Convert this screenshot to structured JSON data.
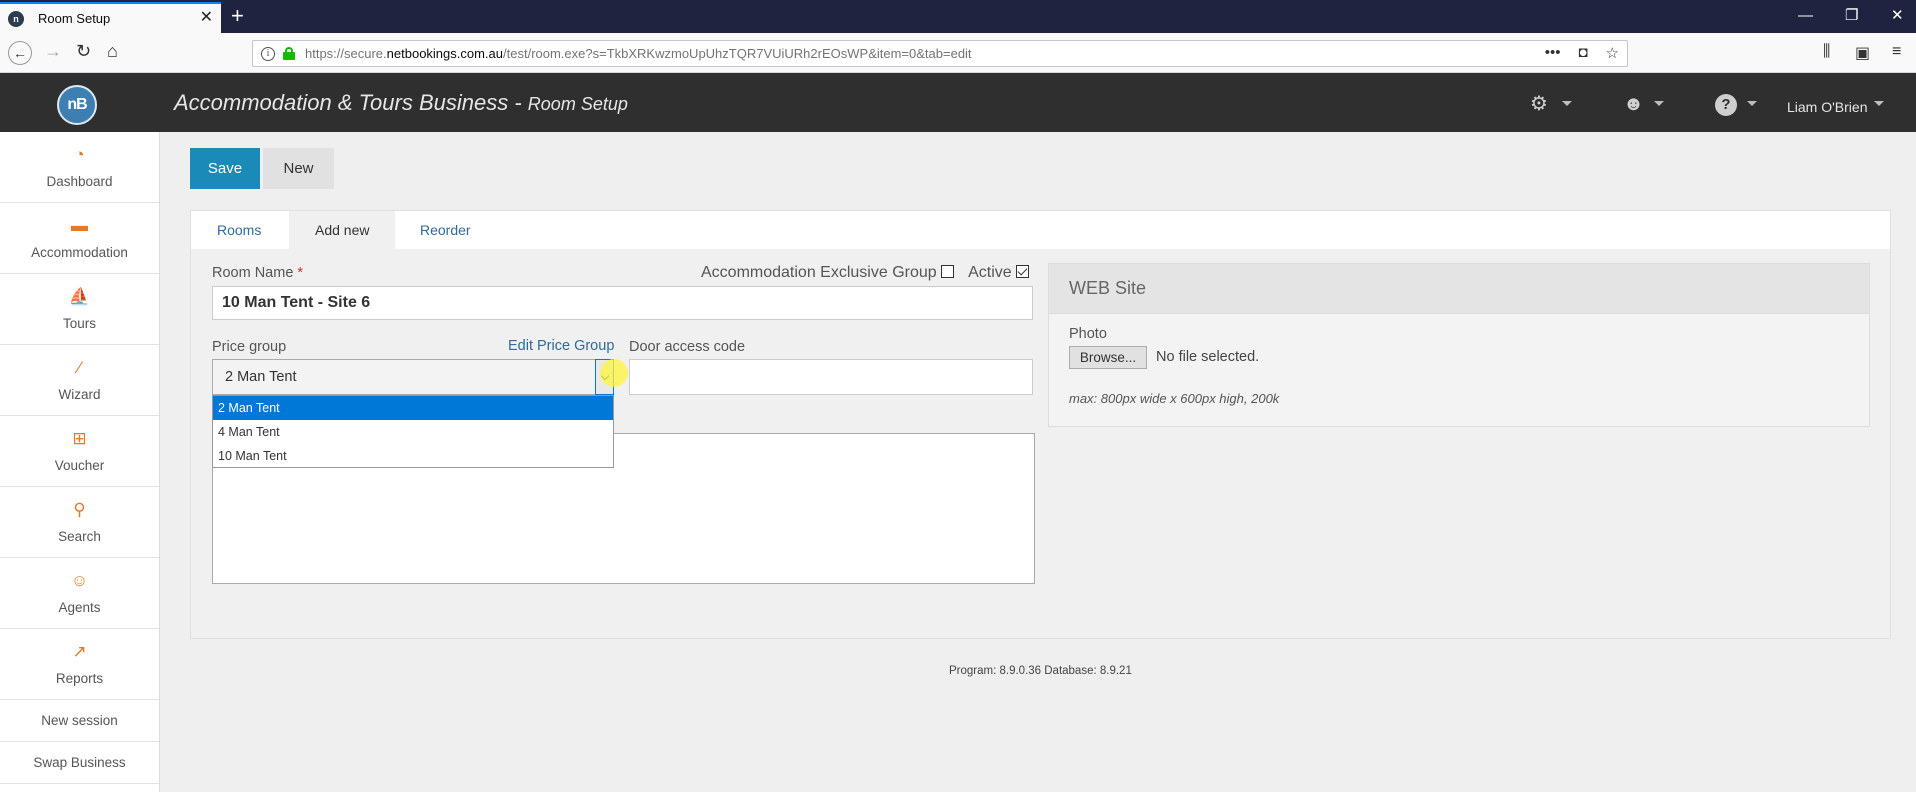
{
  "browser": {
    "tab_title": "Room Setup",
    "favicon_text": "n",
    "url_prefix": "https://secure.",
    "url_domain": "netbookings.com.au",
    "url_rest": "/test/room.exe?s=TkbXRKwzmoUpUhzTQR7VUiURh2rEOsWP&item=0&tab=edit",
    "page_actions_label": "•••"
  },
  "header": {
    "logo_text": "nB",
    "business_name": "Accommodation & Tours Business -",
    "page_name": "Room Setup",
    "user_name": "Liam O'Brien",
    "icons": [
      "settings-gear-icon",
      "agent-icon",
      "help-icon"
    ]
  },
  "sidebar": {
    "items": [
      {
        "label": "Dashboard",
        "icon": "dashboard-gauge-icon"
      },
      {
        "label": "Accommodation",
        "icon": "bed-icon"
      },
      {
        "label": "Tours",
        "icon": "tours-icon"
      },
      {
        "label": "Wizard",
        "icon": "magic-wand-icon"
      },
      {
        "label": "Voucher",
        "icon": "gift-icon"
      },
      {
        "label": "Search",
        "icon": "search-icon"
      },
      {
        "label": "Agents",
        "icon": "agent-icon"
      },
      {
        "label": "Reports",
        "icon": "chart-icon"
      }
    ],
    "links": [
      "New session",
      "Swap Business"
    ]
  },
  "toolbar": {
    "save_label": "Save",
    "new_label": "New"
  },
  "tabs": [
    "Rooms",
    "Add new",
    "Reorder"
  ],
  "form": {
    "room_name_label": "Room Name",
    "required_mark": "*",
    "room_name_value": "10 Man Tent - Site 6",
    "exclusive_group_label": "Accommodation Exclusive Group",
    "exclusive_group_checked": false,
    "active_label": "Active",
    "active_checked": true,
    "price_group_label": "Price group",
    "edit_price_group_label": "Edit Price Group",
    "price_group_value": "2 Man Tent",
    "price_group_options": [
      "2 Man Tent",
      "4 Man Tent",
      "10 Man Tent"
    ],
    "door_access_label": "Door access code",
    "door_access_value": ""
  },
  "website": {
    "title": "WEB Site",
    "photo_label": "Photo",
    "browse_label": "Browse...",
    "no_file_text": "No file selected.",
    "hint": "max: 800px wide x 600px high, 200k"
  },
  "footer": {
    "version_text": "Program: 8.9.0.36 Database: 8.9.21"
  },
  "colors": {
    "accent": "#1a8ab8",
    "header_bg": "#2f2f2f",
    "sidebar_icon": "#e07a2f",
    "link": "#2f6a9a"
  }
}
